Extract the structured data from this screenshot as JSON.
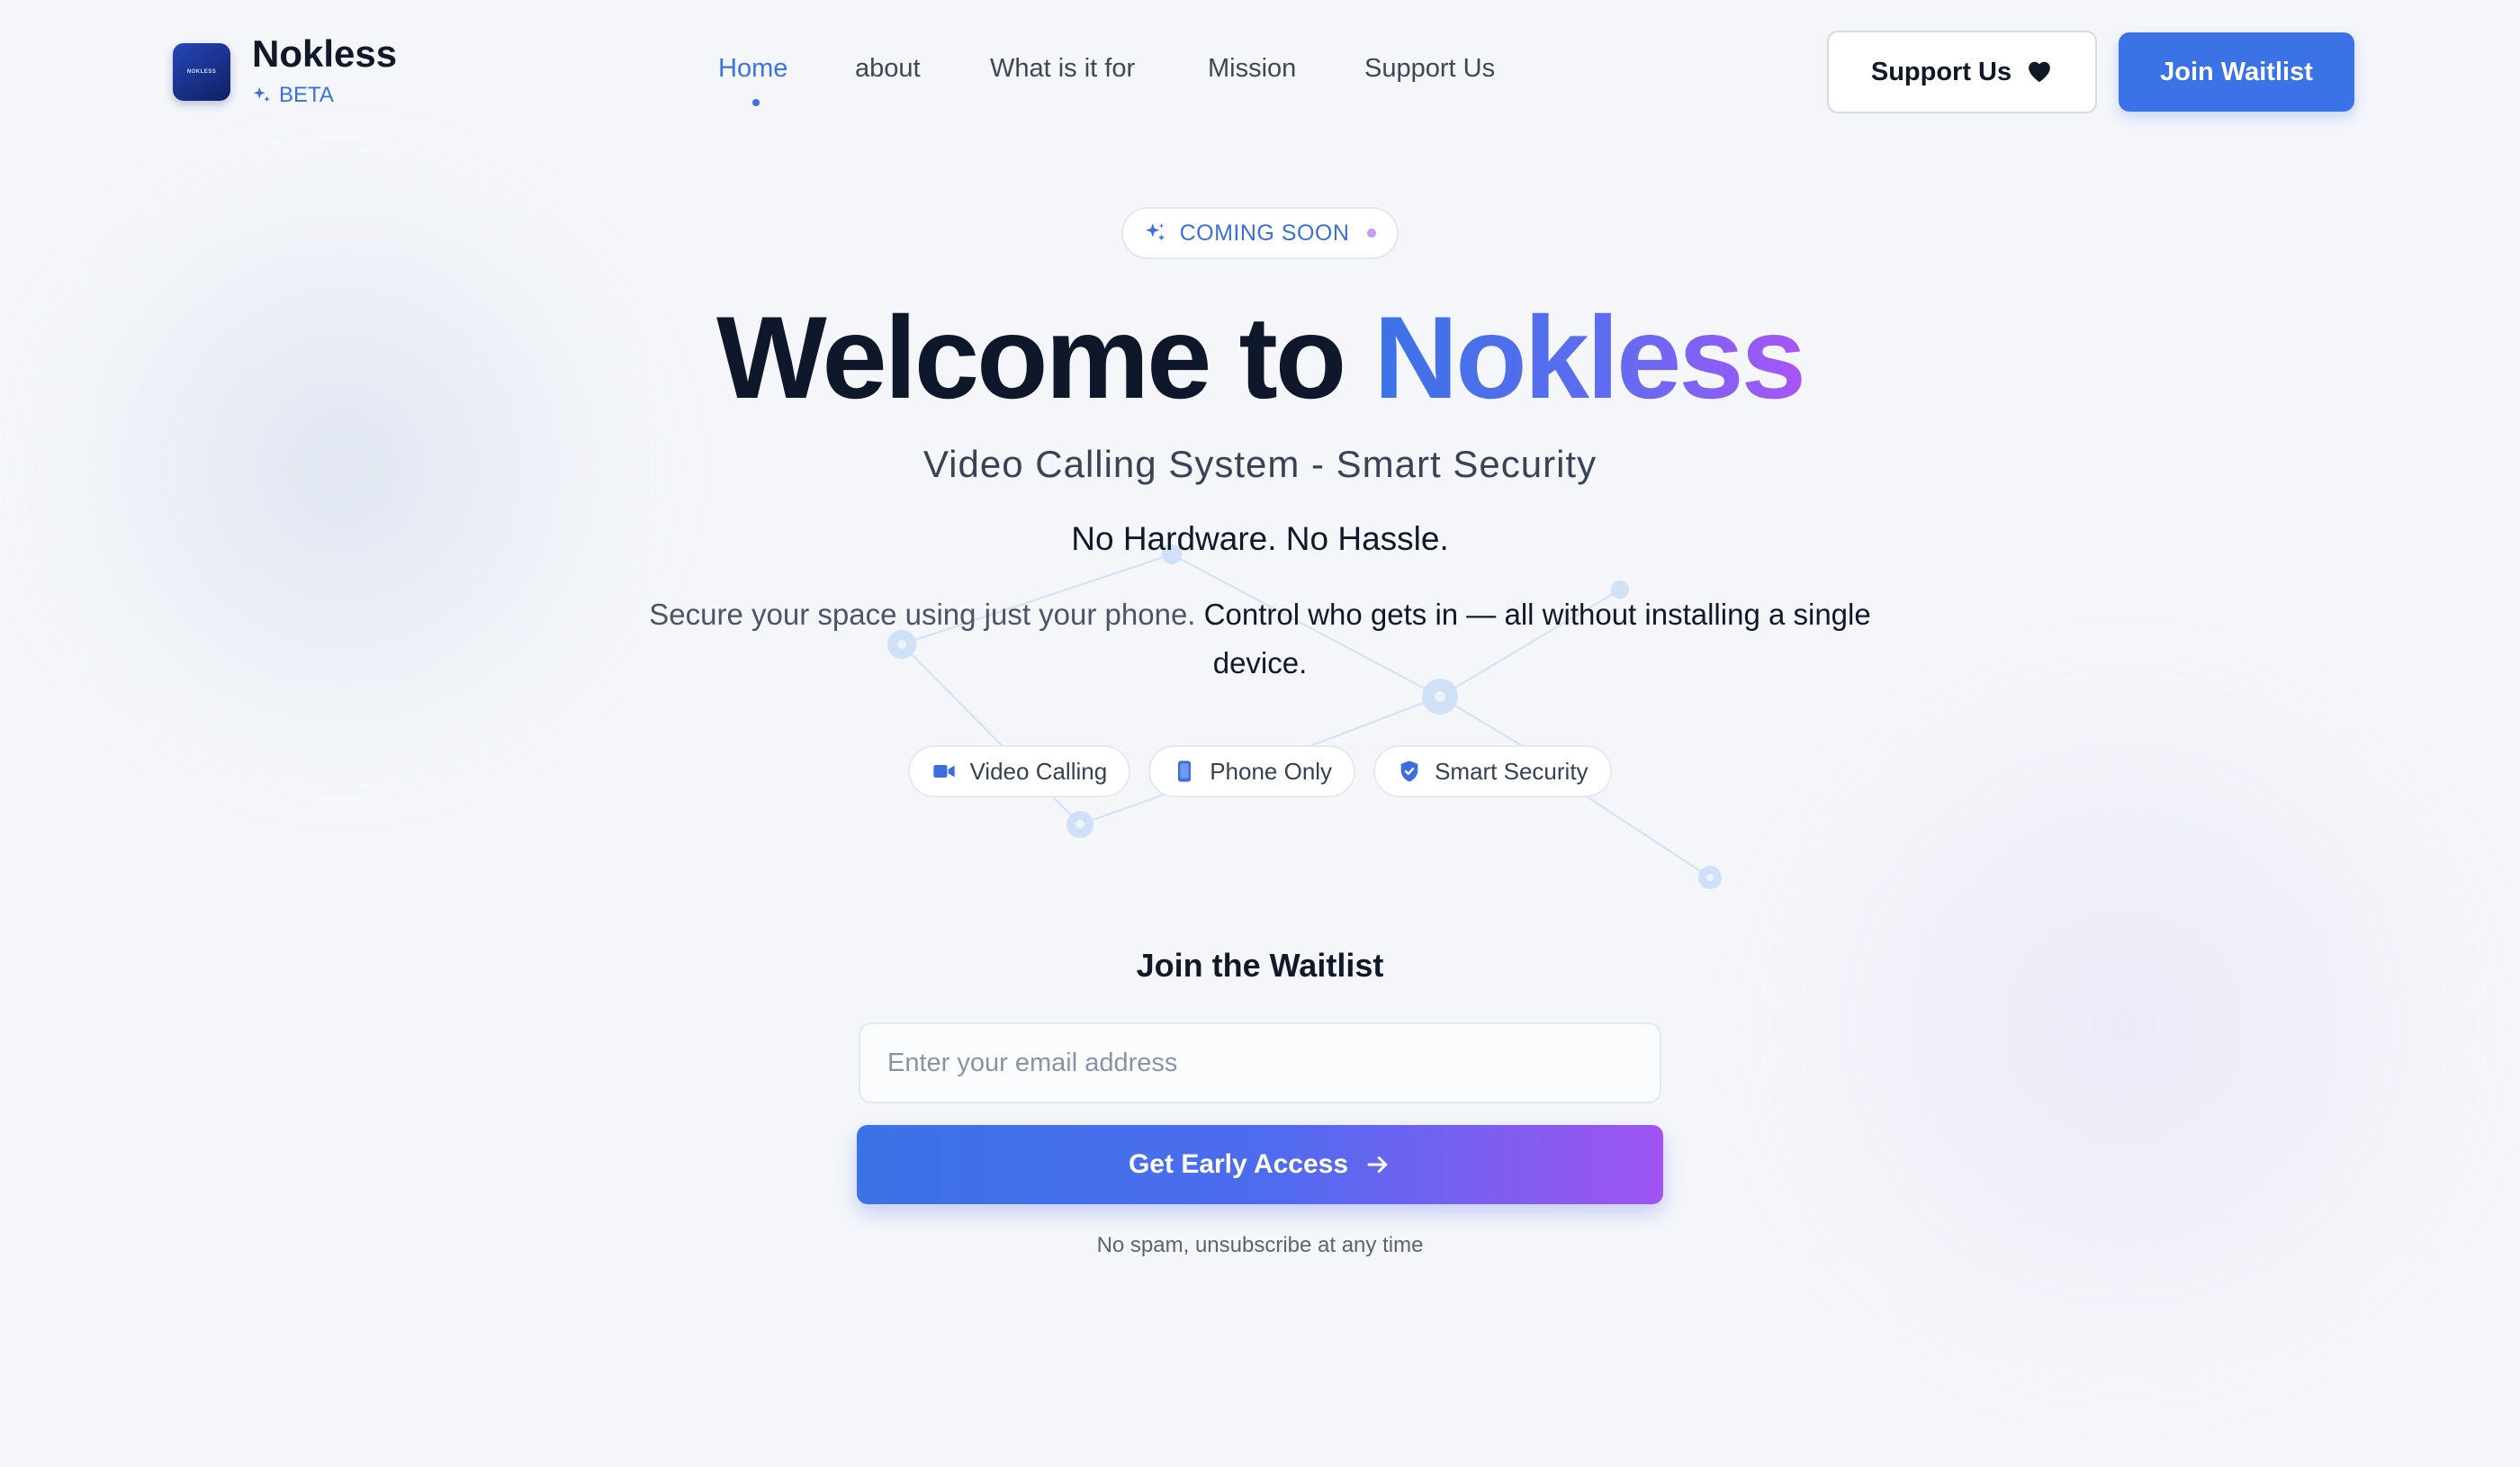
{
  "colors": {
    "accent": "#3b72e6",
    "gradient_start": "#3b72e6",
    "gradient_end": "#a855f7",
    "background": "#f4f6fa"
  },
  "brand": {
    "logo_text": "NOKLESS",
    "name": "Nokless",
    "tag": "BETA",
    "tag_icon": "sparkle-icon"
  },
  "nav": {
    "items": [
      {
        "label": "Home",
        "active": true
      },
      {
        "label": "about",
        "active": false
      },
      {
        "label": "What is it for",
        "active": false
      },
      {
        "label": "Mission",
        "active": false
      },
      {
        "label": "Support Us",
        "active": false
      }
    ]
  },
  "header_actions": {
    "support_label": "Support Us",
    "support_icon": "heart-icon",
    "join_label": "Join Waitlist"
  },
  "hero": {
    "badge_label": "COMING SOON",
    "badge_icon": "sparkle-icon",
    "title_prefix": "Welcome to",
    "title_accent": "Nokless",
    "subtitle": "Video Calling System - Smart Security",
    "tagline": "No Hardware. No Hassle.",
    "desc_muted": "Secure your space using just your phone.",
    "desc_main": "Control who gets in — all without installing a single device.",
    "features": [
      {
        "label": "Video Calling",
        "icon": "video-camera-icon"
      },
      {
        "label": "Phone Only",
        "icon": "smartphone-icon"
      },
      {
        "label": "Smart Security",
        "icon": "shield-check-icon"
      }
    ]
  },
  "waitlist": {
    "title": "Join the Waitlist",
    "email_placeholder": "Enter your email address",
    "email_value": "",
    "button_label": "Get Early Access",
    "button_icon": "arrow-right-icon",
    "note": "No spam, unsubscribe at any time"
  }
}
